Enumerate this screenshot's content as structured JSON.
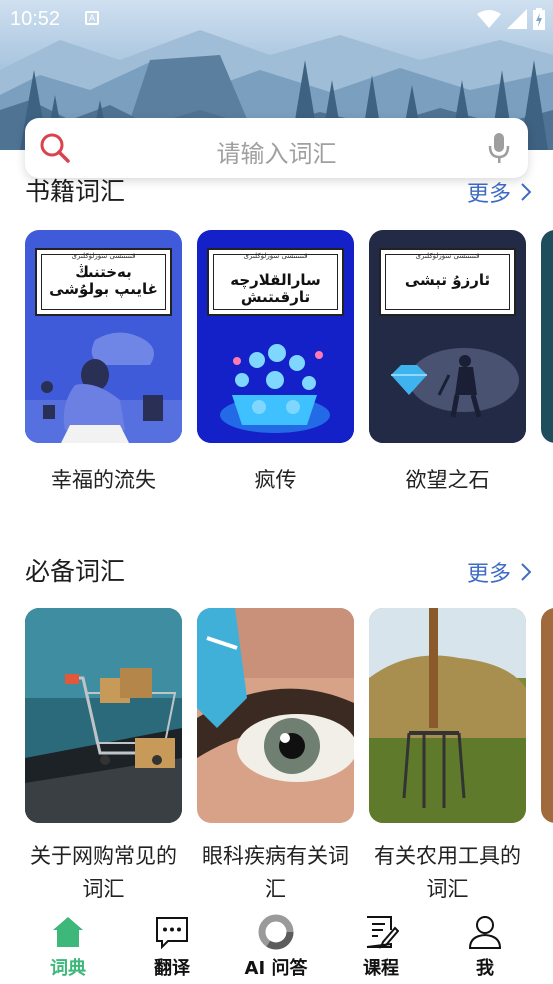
{
  "status_bar": {
    "time": "10:52",
    "app_indicator": "A"
  },
  "search": {
    "placeholder": "请输入词汇"
  },
  "sections": {
    "books": {
      "title": "书籍词汇",
      "more": "更多",
      "items": [
        {
          "label": "幸福的流失",
          "cover_small": "قىنىتىشى سۆزلۈكلىرى",
          "cover_title_line1": "بەختنىڭ",
          "cover_title_line2": "غايىپ بولۇشى",
          "cover_color": "#3f5bd9"
        },
        {
          "label": "疯传",
          "cover_small": "قىنىتىشى سۆزلۈكلىرى",
          "cover_title_line1": "سارالقلارچە تارقىتىش",
          "cover_title_line2": "",
          "cover_color": "#1420c8"
        },
        {
          "label": "欲望之石",
          "cover_small": "قىنىتىشى سۆزلۈكلىرى",
          "cover_title_line1": "ئارزۇ تېشى",
          "cover_title_line2": "",
          "cover_color": "#222a45"
        }
      ]
    },
    "essential": {
      "title": "必备词汇",
      "more": "更多",
      "items": [
        {
          "label": "关于网购常见的词汇"
        },
        {
          "label": "眼科疾病有关词汇"
        },
        {
          "label": "有关农用工具的词汇"
        }
      ]
    }
  },
  "bottom_nav": [
    {
      "label": "词典",
      "icon": "home-icon",
      "active": true
    },
    {
      "label": "翻译",
      "icon": "chat-bubble-icon",
      "active": false
    },
    {
      "label": "AI 问答",
      "icon": "ai-ring-icon",
      "active": false
    },
    {
      "label": "课程",
      "icon": "document-edit-icon",
      "active": false
    },
    {
      "label": "我",
      "icon": "person-icon",
      "active": false
    }
  ],
  "colors": {
    "accent_green": "#3db87a",
    "link_blue": "#3f6cc4",
    "search_red": "#d9434e"
  }
}
